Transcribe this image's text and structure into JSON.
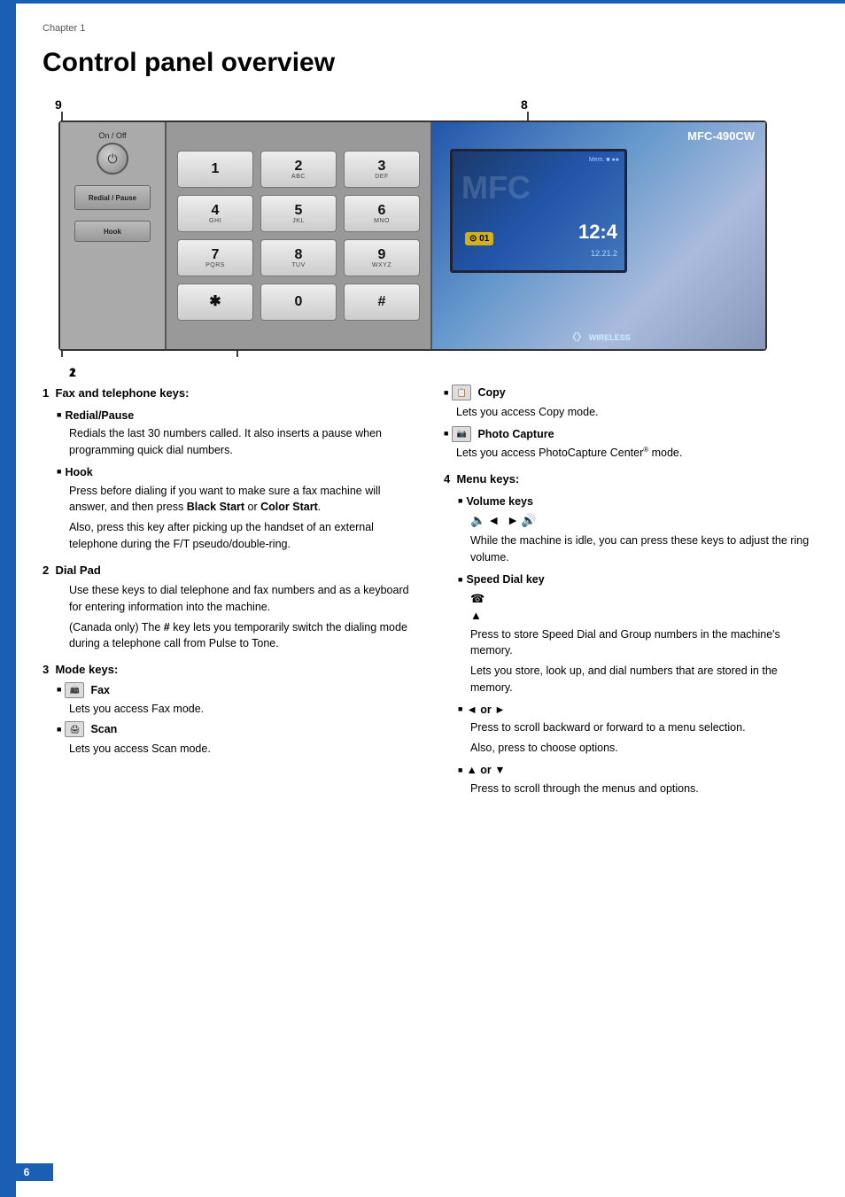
{
  "page": {
    "chapter_label": "Chapter 1",
    "title": "Control panel overview",
    "page_number": "6"
  },
  "diagram": {
    "label_9": "9",
    "label_8": "8",
    "label_1": "1",
    "label_2": "2",
    "on_off_label": "On / Off",
    "on_off_symbol": "⏻",
    "redial_pause": "Redial / Pause",
    "hook": "Hook",
    "model": "MFC-490CW",
    "mem_text": "Mem. ■ ●●",
    "time": "12:4",
    "date": "12.21.2",
    "wireless": "WIRELESS",
    "icon_01": "⊙ 01",
    "dial_keys": [
      {
        "num": "1",
        "letters": ""
      },
      {
        "num": "2",
        "letters": "ABC"
      },
      {
        "num": "3",
        "letters": "DEF"
      },
      {
        "num": "4",
        "letters": "GHI"
      },
      {
        "num": "5",
        "letters": "JKL"
      },
      {
        "num": "6",
        "letters": "MNO"
      },
      {
        "num": "7",
        "letters": "PQRS"
      },
      {
        "num": "8",
        "letters": "TUV"
      },
      {
        "num": "9",
        "letters": "WXYZ"
      },
      {
        "num": "✱",
        "letters": ""
      },
      {
        "num": "0",
        "letters": ""
      },
      {
        "num": "#",
        "letters": ""
      }
    ]
  },
  "sections": {
    "s1_title": "Fax and telephone keys:",
    "s1_num": "1",
    "s1_sub1_head": "Redial/Pause",
    "s1_sub1_text": "Redials the last 30 numbers called. It also inserts a pause when programming quick dial numbers.",
    "s1_sub2_head": "Hook",
    "s1_sub2_text1": "Press before dialing if you want to make sure a fax machine will answer, and then press",
    "s1_sub2_bold": "Black Start",
    "s1_sub2_text2": "or",
    "s1_sub2_bold2": "Color Start",
    "s1_sub2_text3": ".",
    "s1_sub2_text4": "Also, press this key after picking up the handset of an external telephone during the F/T pseudo/double-ring.",
    "s2_num": "2",
    "s2_title": "Dial Pad",
    "s2_text1": "Use these keys to dial telephone and fax numbers and as a keyboard for entering information into the machine.",
    "s2_text2": "(Canada only) The # key lets you temporarily switch the dialing mode during a telephone call from Pulse to Tone.",
    "s3_num": "3",
    "s3_title": "Mode keys:",
    "s3_fax_icon": "fax",
    "s3_fax_label": "Fax",
    "s3_fax_text": "Lets you access Fax mode.",
    "s3_scan_icon": "scan",
    "s3_scan_label": "Scan",
    "s3_scan_text": "Lets you access Scan mode.",
    "s3_copy_icon": "copy",
    "s3_copy_label": "Copy",
    "s3_copy_text": "Lets you access Copy mode.",
    "s3_photo_icon": "photo",
    "s3_photo_label": "Photo Capture",
    "s3_photo_text": "Lets you access PhotoCapture Center® mode.",
    "s4_num": "4",
    "s4_title": "Menu keys:",
    "s4_vol_head": "Volume keys",
    "s4_vol_symbols": "◄◄ ► ►◄◄",
    "s4_vol_text": "While the machine is idle, you can press these keys to adjust the ring volume.",
    "s4_speed_head": "Speed Dial key",
    "s4_speed_text1": "Press to store Speed Dial and Group numbers in the machine's memory.",
    "s4_speed_text2": "Lets you store, look up, and dial numbers that are stored in the memory.",
    "s4_lr_head": "◄ or ►",
    "s4_lr_text1": "Press to scroll backward or forward to a menu selection.",
    "s4_lr_text2": "Also, press to choose options.",
    "s4_ud_head": "▲ or ▼",
    "s4_ud_text": "Press to scroll through the menus and options."
  }
}
